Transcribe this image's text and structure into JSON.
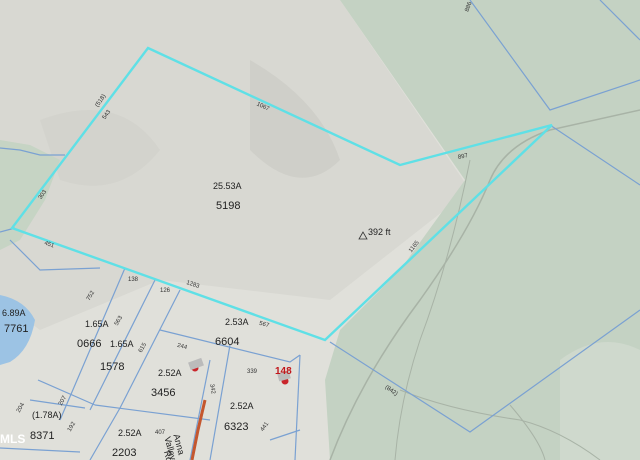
{
  "map": {
    "subject_parcel": {
      "acres": "25.53A",
      "id": "5198"
    },
    "elevation": "392 ft",
    "parcels": [
      {
        "acres": "6.89A",
        "id": "7761"
      },
      {
        "acres": "1.65A",
        "id": "0666"
      },
      {
        "acres": "1.65A",
        "id": "1578"
      },
      {
        "acres": "2.53A",
        "id": "6604"
      },
      {
        "acres": "2.52A",
        "id": "3456"
      },
      {
        "acres": "2.52A",
        "id": "6323"
      },
      {
        "acres": "(1.78A)",
        "id": "8371"
      },
      {
        "acres": "2.52A",
        "id": "2203"
      }
    ],
    "dimensions": [
      "(518)",
      "543",
      "1067",
      "897",
      "303",
      "451",
      "1283",
      "1165",
      "752",
      "138",
      "126",
      "563",
      "615",
      "567",
      "244",
      "339",
      "342",
      "204",
      "207",
      "192",
      "407",
      "441",
      "(842)",
      "886"
    ],
    "road_number": "148",
    "road_label": [
      "Anna",
      "Valley",
      "Rd"
    ],
    "watermark": "MLS"
  }
}
